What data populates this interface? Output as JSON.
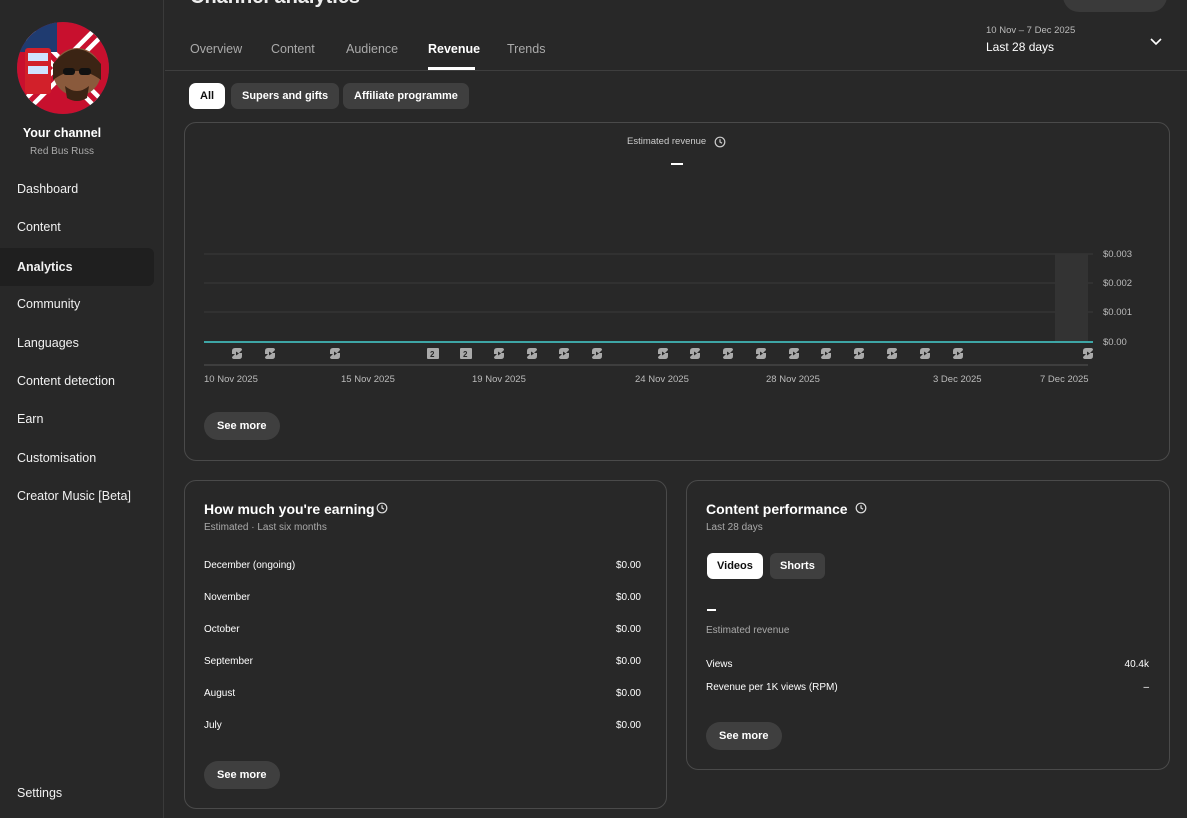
{
  "header": {
    "title": "Channel analytics",
    "tabs": [
      "Overview",
      "Content",
      "Audience",
      "Revenue",
      "Trends"
    ],
    "date_range": "10 Nov – 7 Dec 2025",
    "date_label": "Last 28 days"
  },
  "sidebar": {
    "channel_title": "Your channel",
    "channel_name": "Red Bus Russ",
    "items": [
      {
        "label": "Dashboard"
      },
      {
        "label": "Content"
      },
      {
        "label": "Analytics",
        "active": true
      },
      {
        "label": "Community"
      },
      {
        "label": "Languages"
      },
      {
        "label": "Content detection"
      },
      {
        "label": "Earn"
      },
      {
        "label": "Customisation"
      },
      {
        "label": "Creator Music [Beta]"
      }
    ],
    "settings_label": "Settings"
  },
  "filters": {
    "chips": [
      "All",
      "Supers and gifts",
      "Affiliate programme"
    ],
    "active": "All"
  },
  "revenue_chart": {
    "title": "Estimated revenue",
    "value": "—",
    "y_ticks": [
      "$0.003",
      "$0.002",
      "$0.001",
      "$0.00"
    ],
    "x_ticks": [
      "10 Nov 2025",
      "15 Nov 2025",
      "19 Nov 2025",
      "24 Nov 2025",
      "28 Nov 2025",
      "3 Dec 2025",
      "7 Dec 2025"
    ],
    "marker_badges": [
      "2",
      "2"
    ],
    "see_more": "See more",
    "colors": {
      "line": "#3ea6a6",
      "marker": "#aaaaaa"
    }
  },
  "earning": {
    "title": "How much you're earning",
    "subtitle": "Estimated · Last six months",
    "rows": [
      {
        "month": "December (ongoing)",
        "value": "$0.00"
      },
      {
        "month": "November",
        "value": "$0.00"
      },
      {
        "month": "October",
        "value": "$0.00"
      },
      {
        "month": "September",
        "value": "$0.00"
      },
      {
        "month": "August",
        "value": "$0.00"
      },
      {
        "month": "July",
        "value": "$0.00"
      }
    ],
    "see_more": "See more"
  },
  "performance": {
    "title": "Content performance",
    "subtitle": "Last 28 days",
    "chips": [
      "Videos",
      "Shorts"
    ],
    "active_chip": "Videos",
    "estimated_label": "Estimated revenue",
    "rows": [
      {
        "label": "Views",
        "value": "40.4k"
      },
      {
        "label": "Revenue per 1K views (RPM)",
        "value": "–"
      }
    ],
    "see_more": "See more"
  }
}
